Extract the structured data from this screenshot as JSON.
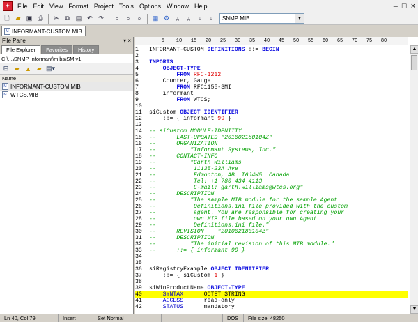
{
  "menubar": {
    "items": [
      "File",
      "Edit",
      "View",
      "Format",
      "Project",
      "Tools",
      "Options",
      "Window",
      "Help"
    ],
    "window_controls": [
      "–",
      "□",
      "×"
    ]
  },
  "toolbar": {
    "icons": [
      "new-file-icon",
      "open-folder-icon",
      "save-icon",
      "print-icon",
      "cut-icon",
      "copy-icon",
      "paste-icon",
      "undo-icon",
      "redo-icon",
      "find-icon",
      "find-replace-icon",
      "find-next-icon",
      "compile-icon",
      "mib-browser-icon",
      "mib-tree-icon",
      "snmp-icon",
      "snmp-walk-icon"
    ],
    "combo_value": "SNMP MIB"
  },
  "document_tab": {
    "label": "INFORMANT-CUSTOM.MIB"
  },
  "file_panel": {
    "title": "File Panel",
    "controls": "▾ ×",
    "tabs": [
      "File Explorer",
      "Favorites",
      "History"
    ],
    "path": "C:\\...\\SNMP Informant\\mibs\\SMIv1",
    "column_header": "Name",
    "files": [
      "INFORMANT-CUSTOM.MIB",
      "WTCS.MIB"
    ]
  },
  "ruler": "         5    10   15   20   25   30   35   40   45   50   55   60   65   70   75   80",
  "code_lines": [
    {
      "n": "1",
      "t": [
        [
          "pl",
          "INFORMANT-CUSTOM "
        ],
        [
          "kw",
          "DEFINITIONS"
        ],
        [
          "pl",
          " ::= "
        ],
        [
          "kw",
          "BEGIN"
        ]
      ]
    },
    {
      "n": "2",
      "t": []
    },
    {
      "n": "3",
      "t": [
        [
          "kw",
          "IMPORTS"
        ]
      ]
    },
    {
      "n": "4",
      "t": [
        [
          "pl",
          "    "
        ],
        [
          "kw",
          "OBJECT-TYPE"
        ]
      ]
    },
    {
      "n": "5",
      "t": [
        [
          "pl",
          "        "
        ],
        [
          "kw",
          "FROM"
        ],
        [
          "pl",
          " "
        ],
        [
          "nm",
          "RFC-1212"
        ]
      ]
    },
    {
      "n": "6",
      "t": [
        [
          "pl",
          "    Counter, Gauge"
        ]
      ]
    },
    {
      "n": "7",
      "t": [
        [
          "pl",
          "        "
        ],
        [
          "kw",
          "FROM"
        ],
        [
          "pl",
          " RFC1155-SMI"
        ]
      ]
    },
    {
      "n": "8",
      "t": [
        [
          "pl",
          "    informant"
        ]
      ]
    },
    {
      "n": "9",
      "t": [
        [
          "pl",
          "        "
        ],
        [
          "kw",
          "FROM"
        ],
        [
          "pl",
          " WTCS;"
        ]
      ]
    },
    {
      "n": "10",
      "t": []
    },
    {
      "n": "11",
      "t": [
        [
          "pl",
          "siCustom "
        ],
        [
          "kw",
          "OBJECT IDENTIFIER"
        ]
      ]
    },
    {
      "n": "12",
      "t": [
        [
          "pl",
          "    ::= { informant "
        ],
        [
          "nm",
          "99"
        ],
        [
          "pl",
          " }"
        ]
      ]
    },
    {
      "n": "13",
      "t": []
    },
    {
      "n": "14",
      "t": [
        [
          "cm",
          "-- siCustom MODULE-IDENTITY"
        ]
      ]
    },
    {
      "n": "15",
      "t": [
        [
          "cm",
          "--      LAST-UPDATED \"201002180104Z\""
        ]
      ]
    },
    {
      "n": "16",
      "t": [
        [
          "cm",
          "--      ORGANIZATION"
        ]
      ]
    },
    {
      "n": "17",
      "t": [
        [
          "cm",
          "--          \"Informant Systems, Inc.\""
        ]
      ]
    },
    {
      "n": "18",
      "t": [
        [
          "cm",
          "--      CONTACT-INFO"
        ]
      ]
    },
    {
      "n": "19",
      "t": [
        [
          "cm",
          "--          \"Garth Williams"
        ]
      ]
    },
    {
      "n": "20",
      "t": [
        [
          "cm",
          "--           11135-23A Ave"
        ]
      ]
    },
    {
      "n": "21",
      "t": [
        [
          "cm",
          "--           Edmonton, AB  T6J4W5  Canada"
        ]
      ]
    },
    {
      "n": "22",
      "t": [
        [
          "cm",
          "--           Tel: +1 780 434 4113"
        ]
      ]
    },
    {
      "n": "23",
      "t": [
        [
          "cm",
          "--           E-mail: garth.williams@wtcs.org\""
        ]
      ]
    },
    {
      "n": "24",
      "t": [
        [
          "cm",
          "--      DESCRIPTION"
        ]
      ]
    },
    {
      "n": "25",
      "t": [
        [
          "cm",
          "--          \"The sample MIB module for the sample Agent"
        ]
      ]
    },
    {
      "n": "26",
      "t": [
        [
          "cm",
          "--           Definitions.ini file provided with the custom"
        ]
      ]
    },
    {
      "n": "27",
      "t": [
        [
          "cm",
          "--           agent. You are responsible for creating your"
        ]
      ]
    },
    {
      "n": "28",
      "t": [
        [
          "cm",
          "--           own MIB file based on your own Agent"
        ]
      ]
    },
    {
      "n": "29",
      "t": [
        [
          "cm",
          "--           Definitions.ini file.\""
        ]
      ]
    },
    {
      "n": "30",
      "t": [
        [
          "cm",
          "--      REVISION    \"201002180104Z\""
        ]
      ]
    },
    {
      "n": "31",
      "t": [
        [
          "cm",
          "--      DESCRIPTION"
        ]
      ]
    },
    {
      "n": "32",
      "t": [
        [
          "cm",
          "--          \"The initial revision of this MIB module.\""
        ]
      ]
    },
    {
      "n": "33",
      "t": [
        [
          "cm",
          "--      ::= { informant 99 }"
        ]
      ]
    },
    {
      "n": "34",
      "t": []
    },
    {
      "n": "35",
      "t": []
    },
    {
      "n": "36",
      "t": [
        [
          "pl",
          "siRegistryExample "
        ],
        [
          "kw",
          "OBJECT IDENTIFIER"
        ]
      ]
    },
    {
      "n": "37",
      "t": [
        [
          "pl",
          "    ::= { siCustom "
        ],
        [
          "nm",
          "1"
        ],
        [
          "pl",
          " }"
        ]
      ]
    },
    {
      "n": "38",
      "t": []
    },
    {
      "n": "39",
      "t": [
        [
          "pl",
          "siWinProductName "
        ],
        [
          "kw",
          "OBJECT-TYPE"
        ]
      ]
    },
    {
      "n": "40",
      "t": [
        [
          "pl",
          "    "
        ],
        [
          "bl",
          "SYNTAX"
        ],
        [
          "pl",
          "      OCTET STRING"
        ]
      ],
      "hl": true
    },
    {
      "n": "41",
      "t": [
        [
          "pl",
          "    "
        ],
        [
          "bl",
          "ACCESS"
        ],
        [
          "pl",
          "      read-only"
        ]
      ]
    },
    {
      "n": "42",
      "t": [
        [
          "pl",
          "    "
        ],
        [
          "bl",
          "STATUS"
        ],
        [
          "pl",
          "      mandatory"
        ]
      ]
    }
  ],
  "statusbar": {
    "position": "Ln 40, Col 79",
    "mode": "Insert",
    "format": "Set Normal",
    "blank": "",
    "encoding": "DOS",
    "file_size": "File size: 48250"
  },
  "colors": {
    "keyword": "#1010e0",
    "comment": "#00a000",
    "number": "#e00000",
    "highlight": "#ffff00"
  }
}
